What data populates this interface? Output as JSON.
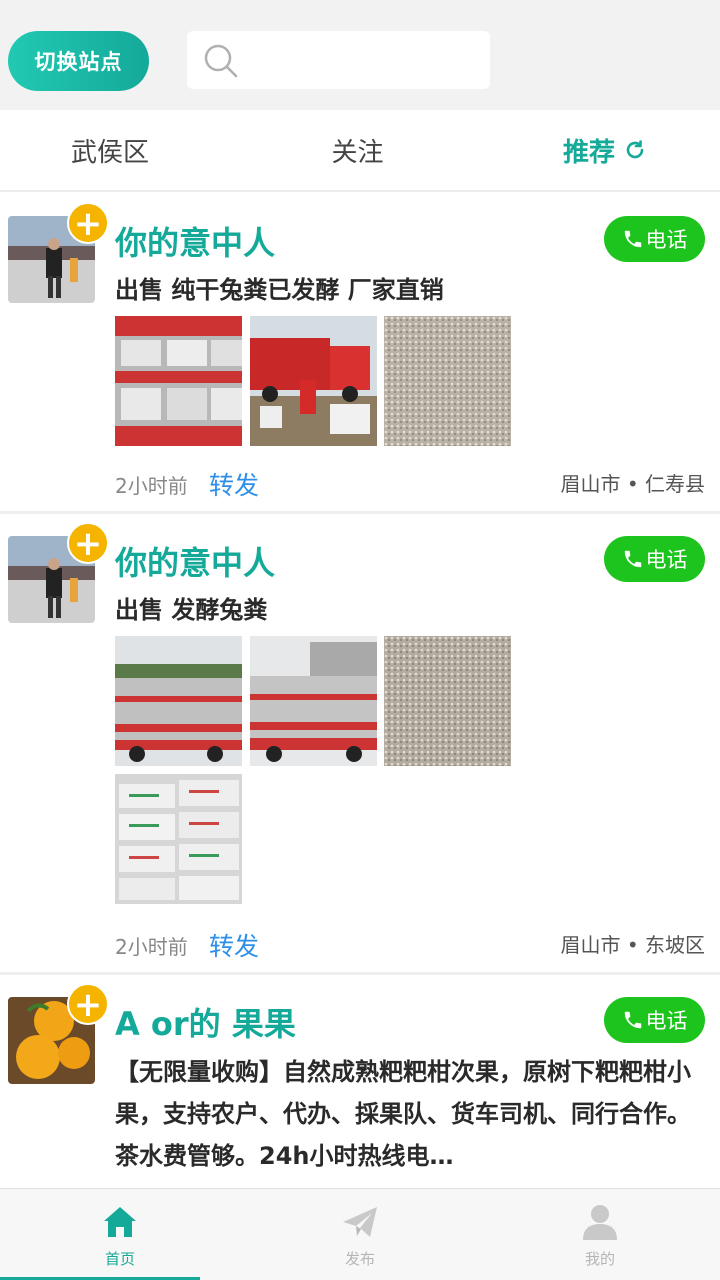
{
  "header": {
    "site_button": "切换站点",
    "search_placeholder": ""
  },
  "tabs": [
    {
      "label": "武侯区"
    },
    {
      "label": "关注"
    },
    {
      "label": "推荐"
    }
  ],
  "posts": [
    {
      "name": "你的意中人",
      "call_label": "电话",
      "title": "出售 纯干兔粪已发酵 厂家直销",
      "time": "2小时前",
      "forward_label": "转发",
      "location": "眉山市 • 仁寿县"
    },
    {
      "name": "你的意中人",
      "call_label": "电话",
      "title": "出售 发酵兔粪",
      "time": "2小时前",
      "forward_label": "转发",
      "location": "眉山市 • 东坡区"
    },
    {
      "name": "A or的 果果",
      "call_label": "电话",
      "title": "【无限量收购】自然成熟粑粑柑次果，原树下粑粑柑小果，支持农户、代办、採果队、货车司机、同行合作。茶水费管够。24h小时热线电…"
    }
  ],
  "bottom_nav": [
    {
      "label": "首页",
      "icon": "home-icon",
      "active": true
    },
    {
      "label": "发布",
      "icon": "paper-plane-icon",
      "active": false
    },
    {
      "label": "我的",
      "icon": "user-icon",
      "active": false
    }
  ],
  "colors": {
    "accent": "#15a99a",
    "call_green": "#1dc41d",
    "plus_yellow": "#f5b400",
    "forward_blue": "#2e8fe8"
  }
}
